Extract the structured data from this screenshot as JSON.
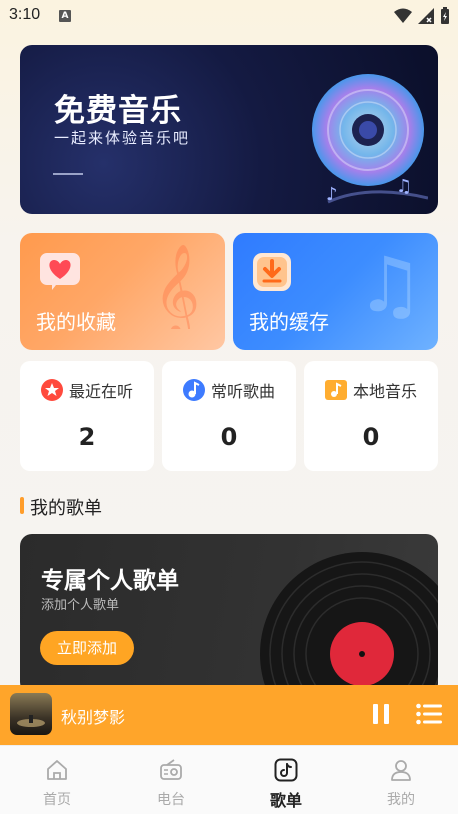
{
  "status_bar": {
    "time": "3:10",
    "notif_badge": "A"
  },
  "banner": {
    "title": "免费音乐",
    "subtitle": "一起来体验音乐吧"
  },
  "features": [
    {
      "label": "我的收藏",
      "icon": "heart-icon"
    },
    {
      "label": "我的缓存",
      "icon": "download-icon"
    }
  ],
  "stats": [
    {
      "label": "最近在听",
      "value": "2",
      "icon": "star-icon",
      "color": "#ff4a3d"
    },
    {
      "label": "常听歌曲",
      "value": "0",
      "icon": "music-note-icon",
      "color": "#3d7bff"
    },
    {
      "label": "本地音乐",
      "value": "0",
      "icon": "music-folder-icon",
      "color": "#ffad30"
    }
  ],
  "section": {
    "title": "我的歌单"
  },
  "promo": {
    "title": "专属个人歌单",
    "subtitle": "添加个人歌单",
    "button": "立即添加"
  },
  "player": {
    "song_title": "秋别梦影"
  },
  "tabs": [
    {
      "label": "首页",
      "icon": "home-icon",
      "active": false
    },
    {
      "label": "电台",
      "icon": "radio-icon",
      "active": false
    },
    {
      "label": "歌单",
      "icon": "tiktok-note-icon",
      "active": true
    },
    {
      "label": "我的",
      "icon": "user-icon",
      "active": false
    }
  ],
  "colors": {
    "accent": "#ffa52a",
    "blue": "#3d8dff",
    "banner": "#141a42"
  }
}
